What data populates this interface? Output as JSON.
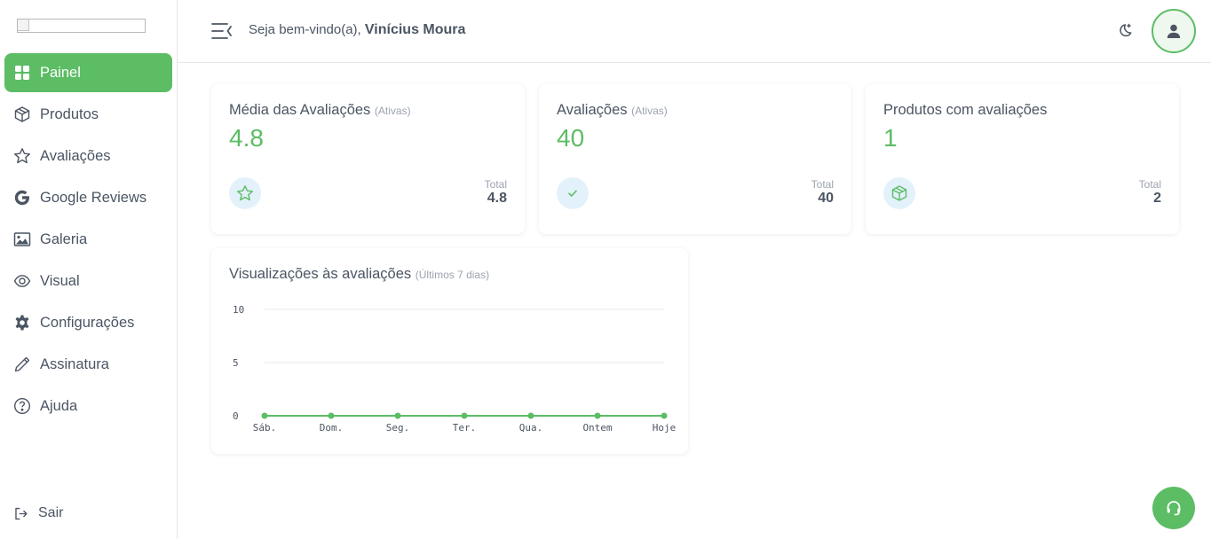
{
  "sidebar": {
    "items": [
      {
        "label": "Painel",
        "icon": "dashboard-icon"
      },
      {
        "label": "Produtos",
        "icon": "box-icon"
      },
      {
        "label": "Avaliações",
        "icon": "star-icon"
      },
      {
        "label": "Google Reviews",
        "icon": "google-icon"
      },
      {
        "label": "Galeria",
        "icon": "image-icon"
      },
      {
        "label": "Visual",
        "icon": "eye-icon"
      },
      {
        "label": "Configurações",
        "icon": "gear-icon"
      },
      {
        "label": "Assinatura",
        "icon": "pen-icon"
      },
      {
        "label": "Ajuda",
        "icon": "help-icon"
      }
    ],
    "active_index": 0,
    "logout_label": "Sair"
  },
  "header": {
    "greeting": "Seja bem-vindo(a),",
    "user_name": "Vinícius Moura"
  },
  "stats": [
    {
      "title": "Média das Avaliações",
      "qualifier": "(Ativas)",
      "value": "4.8",
      "total_label": "Total",
      "total_value": "4.8",
      "icon": "star-icon"
    },
    {
      "title": "Avaliações",
      "qualifier": "(Ativas)",
      "value": "40",
      "total_label": "Total",
      "total_value": "40",
      "icon": "check-icon"
    },
    {
      "title": "Produtos com avaliações",
      "qualifier": "",
      "value": "1",
      "total_label": "Total",
      "total_value": "2",
      "icon": "box-icon"
    }
  ],
  "views_chart": {
    "title": "Visualizações às avaliações",
    "qualifier": "(Últimos 7 dias)"
  },
  "chart_data": {
    "type": "line",
    "categories": [
      "Sáb.",
      "Dom.",
      "Seg.",
      "Ter.",
      "Qua.",
      "Ontem",
      "Hoje"
    ],
    "series": [
      {
        "values": [
          0,
          0,
          0,
          0,
          0,
          0,
          0
        ]
      }
    ],
    "yticks": [
      0,
      5,
      10
    ],
    "ylim": [
      0,
      10
    ],
    "grid": true,
    "color": "#5cbd64"
  },
  "colors": {
    "accent": "#5cbd64",
    "text": "#4b5563",
    "muted": "#9ca3af",
    "badge_bg": "#e3f1fb"
  }
}
